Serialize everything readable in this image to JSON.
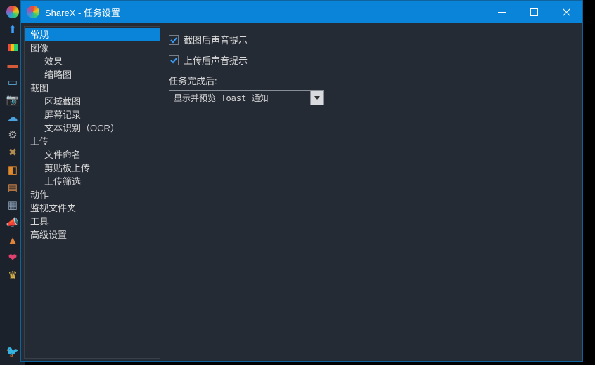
{
  "window": {
    "title": "ShareX - 任务设置"
  },
  "tree": [
    {
      "label": "常规",
      "child": false,
      "selected": true
    },
    {
      "label": "图像",
      "child": false,
      "selected": false
    },
    {
      "label": "效果",
      "child": true,
      "selected": false
    },
    {
      "label": "缩略图",
      "child": true,
      "selected": false
    },
    {
      "label": "截图",
      "child": false,
      "selected": false
    },
    {
      "label": "区域截图",
      "child": true,
      "selected": false
    },
    {
      "label": "屏幕记录",
      "child": true,
      "selected": false
    },
    {
      "label": "文本识别（OCR）",
      "child": true,
      "selected": false
    },
    {
      "label": "上传",
      "child": false,
      "selected": false
    },
    {
      "label": "文件命名",
      "child": true,
      "selected": false
    },
    {
      "label": "剪贴板上传",
      "child": true,
      "selected": false
    },
    {
      "label": "上传筛选",
      "child": true,
      "selected": false
    },
    {
      "label": "动作",
      "child": false,
      "selected": false
    },
    {
      "label": "监视文件夹",
      "child": false,
      "selected": false
    },
    {
      "label": "工具",
      "child": false,
      "selected": false
    },
    {
      "label": "高级设置",
      "child": false,
      "selected": false
    }
  ],
  "content": {
    "checkbox1_label": "截图后声音提示",
    "checkbox1_checked": true,
    "checkbox2_label": "上传后声音提示",
    "checkbox2_checked": true,
    "after_task_label": "任务完成后:",
    "after_task_value": "显示并预览 Toast 通知"
  },
  "outer_icons": [
    "logo",
    "home",
    "grid",
    "briefcase",
    "window",
    "camera",
    "cloud",
    "gear",
    "wrench",
    "color",
    "news",
    "layers",
    "megaphone",
    "traffic",
    "heart",
    "crown"
  ],
  "footer_icon": "twitter"
}
